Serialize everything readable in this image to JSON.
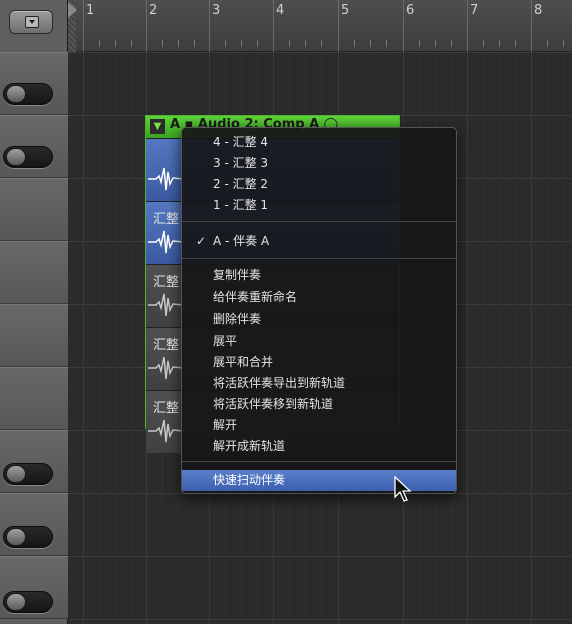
{
  "ruler": {
    "bars": [
      "1",
      "2",
      "3",
      "4",
      "5",
      "6",
      "7",
      "8"
    ]
  },
  "region": {
    "disclosure": "▼",
    "title": "A  ▪  Audio 2: Comp A  ◯"
  },
  "comps": [
    {
      "name": "",
      "state": "active"
    },
    {
      "name": "汇整",
      "state": "active"
    },
    {
      "name": "汇整",
      "state": "inactive"
    },
    {
      "name": "汇整",
      "state": "inactive"
    },
    {
      "name": "汇整",
      "state": "inactive"
    }
  ],
  "menu": {
    "takes": [
      "4 - 汇整 4",
      "3 - 汇整 3",
      "2 - 汇整 2",
      "1 - 汇整 1"
    ],
    "current_take": "A - 伴奏 A",
    "check": "✓",
    "actions": [
      "复制伴奏",
      "给伴奏重新命名",
      "删除伴奏",
      "展平",
      "展平和合并",
      "将活跃伴奏导出到新轨道",
      "将活跃伴奏移到新轨道",
      "解开",
      "解开成新轨道"
    ],
    "quick_swipe": "快速扫动伴奏"
  },
  "colors": {
    "region_green": "#4fb62c",
    "active_comp": "#4a6cb5",
    "menu_select": "#4a6fbd"
  }
}
